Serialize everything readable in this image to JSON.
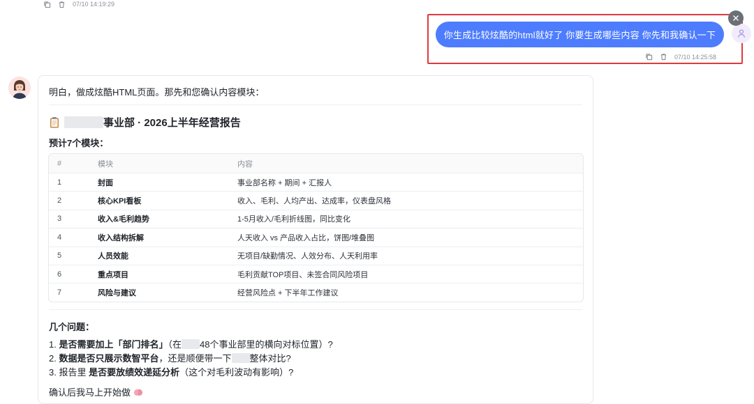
{
  "top_meta": {
    "timestamp": "07/10 14:19:29"
  },
  "user_message": {
    "text": "你生成比较炫酷的html就好了 你要生成哪些内容 你先和我确认一下",
    "timestamp": "07/10 14:25:58"
  },
  "assistant": {
    "intro": "明白，做成炫酷HTML页面。那先和您确认内容模块：",
    "report_title": "事业部 · 2026上半年经营报告",
    "modules_heading": "预计7个模块：",
    "table": {
      "headers": [
        "#",
        "模块",
        "内容"
      ],
      "rows": [
        [
          "1",
          "封面",
          "事业部名称 + 期间 + 汇报人"
        ],
        [
          "2",
          "核心KPI看板",
          "收入、毛利、人均产出、达成率，仪表盘风格"
        ],
        [
          "3",
          "收入&毛利趋势",
          "1-5月收入/毛利折线图，同比变化"
        ],
        [
          "4",
          "收入结构拆解",
          "人天收入 vs 产品收入占比，饼图/堆叠图"
        ],
        [
          "5",
          "人员效能",
          "无项目/缺勤情况、人效分布、人天利用率"
        ],
        [
          "6",
          "重点项目",
          "毛利贡献TOP项目、未签合同风险项目"
        ],
        [
          "7",
          "风险与建议",
          "经营风险点 + 下半年工作建议"
        ]
      ]
    },
    "questions_heading": "几个问题：",
    "questions": [
      {
        "prefix": "1. ",
        "bold": "是否需要加上「部门排名」",
        "rest_a": "（在",
        "rest_b": "48个事业部里的横向对标位置）?"
      },
      {
        "prefix": "2. ",
        "bold": "数据是否只展示数智平台",
        "rest_a": "，还是顺便带一下",
        "rest_b": "整体对比?"
      },
      {
        "prefix": "3. 报告里 ",
        "bold": "是否要放绩效递延分析",
        "rest_a": "（这个对毛利波动有影响）?",
        "rest_b": ""
      }
    ],
    "closing": "确认后我马上开始做"
  },
  "colors": {
    "bubble": "#4d7cfe",
    "highlight": "#e0393e"
  }
}
